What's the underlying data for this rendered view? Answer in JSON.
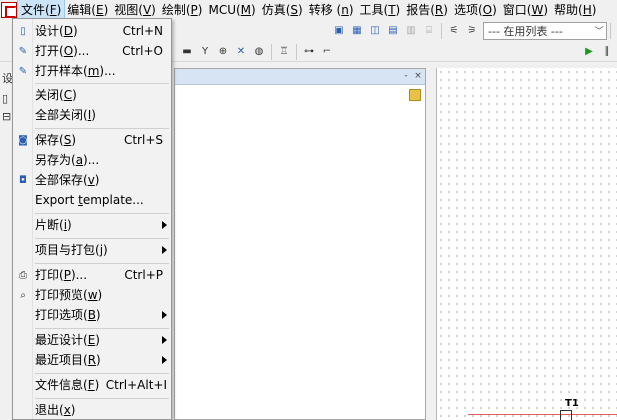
{
  "menubar": {
    "items": [
      {
        "label": "文件(",
        "key": "F",
        "tail": ")"
      },
      {
        "label": "编辑(",
        "key": "E",
        "tail": ")"
      },
      {
        "label": "视图(",
        "key": "V",
        "tail": ")"
      },
      {
        "label": "绘制(",
        "key": "P",
        "tail": ")"
      },
      {
        "label": "MCU(",
        "key": "M",
        "tail": ")"
      },
      {
        "label": "仿真(",
        "key": "S",
        "tail": ")"
      },
      {
        "label": "转移 (",
        "key": "n",
        "tail": ")"
      },
      {
        "label": "工具(",
        "key": "T",
        "tail": ")"
      },
      {
        "label": "报告(",
        "key": "R",
        "tail": ")"
      },
      {
        "label": "选项(",
        "key": "O",
        "tail": ")"
      },
      {
        "label": "窗口(",
        "key": "W",
        "tail": ")"
      },
      {
        "label": "帮助(",
        "key": "H",
        "tail": ")"
      }
    ]
  },
  "toolbar": {
    "in_use_list_combo": "--- 在用列表 ---"
  },
  "left_edge": {
    "tab_label": "设"
  },
  "file_menu": {
    "items": [
      {
        "label": "设计(",
        "key": "D",
        "tail": ")",
        "shortcut": "Ctrl+N",
        "icon": "new-document-icon"
      },
      {
        "label": "打开(",
        "key": "O",
        "tail": ")...",
        "shortcut": "Ctrl+O",
        "icon": "open-folder-icon"
      },
      {
        "label": "打开样本(",
        "key": "m",
        "tail": ")...",
        "shortcut": "",
        "icon": "open-sample-icon"
      },
      {
        "label": "关闭(",
        "key": "C",
        "tail": ")",
        "shortcut": "",
        "icon": ""
      },
      {
        "label": "全部关闭(",
        "key": "I",
        "tail": ")",
        "shortcut": "",
        "icon": ""
      },
      {
        "label": "保存(",
        "key": "S",
        "tail": ")",
        "shortcut": "Ctrl+S",
        "icon": "save-icon"
      },
      {
        "label": "另存为(",
        "key": "a",
        "tail": ")...",
        "shortcut": "",
        "icon": ""
      },
      {
        "label": "全部保存(",
        "key": "v",
        "tail": ")",
        "shortcut": "",
        "icon": "save-all-icon"
      },
      {
        "label": "Export ",
        "key": "t",
        "tail": "emplate...",
        "shortcut": "",
        "icon": ""
      },
      {
        "label": "片断(",
        "key": "i",
        "tail": ")",
        "shortcut": "",
        "icon": "",
        "submenu": true
      },
      {
        "label": "项目与打包(",
        "key": "j",
        "tail": ")",
        "shortcut": "",
        "icon": "",
        "submenu": true
      },
      {
        "label": "打印(",
        "key": "P",
        "tail": ")...",
        "shortcut": "Ctrl+P",
        "icon": "print-icon"
      },
      {
        "label": "打印预览(",
        "key": "w",
        "tail": ")",
        "shortcut": "",
        "icon": "print-preview-icon"
      },
      {
        "label": "打印选项(",
        "key": "B",
        "tail": ")",
        "shortcut": "",
        "icon": "",
        "submenu": true
      },
      {
        "label": "最近设计(",
        "key": "E",
        "tail": ")",
        "shortcut": "",
        "icon": "",
        "submenu": true
      },
      {
        "label": "最近项目(",
        "key": "R",
        "tail": ")",
        "shortcut": "",
        "icon": "",
        "submenu": true
      },
      {
        "label": "文件信息(",
        "key": "F",
        "tail": ")",
        "shortcut": "Ctrl+Alt+I",
        "icon": ""
      },
      {
        "label": "退出(",
        "key": "x",
        "tail": ")",
        "shortcut": "",
        "icon": ""
      }
    ]
  },
  "sheet": {
    "component_label": "T1"
  }
}
